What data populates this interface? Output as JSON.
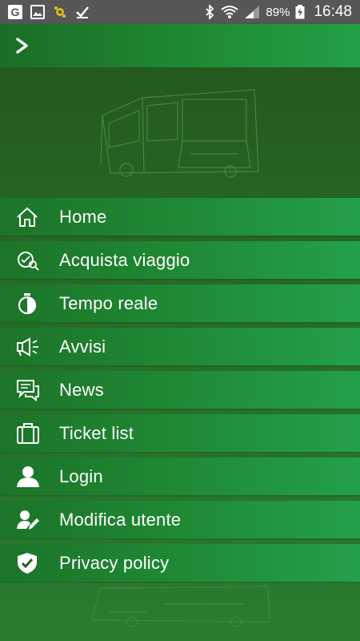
{
  "status_bar": {
    "battery": "89%",
    "time": "16:48",
    "left_icons": [
      "google-icon",
      "image-icon",
      "app-icon",
      "check-icon"
    ],
    "right_icons": [
      "bluetooth-icon",
      "wifi-icon",
      "signal-icon",
      "battery-icon"
    ]
  },
  "app_bar": {
    "toggle_icon": "chevron-right-icon"
  },
  "menu": {
    "items": [
      {
        "label": "Home",
        "icon": "home-icon"
      },
      {
        "label": "Acquista viaggio",
        "icon": "search-ticket-icon"
      },
      {
        "label": "Tempo reale",
        "icon": "stopwatch-icon"
      },
      {
        "label": "Avvisi",
        "icon": "megaphone-icon"
      },
      {
        "label": "News",
        "icon": "chat-bubbles-icon"
      },
      {
        "label": "Ticket list",
        "icon": "briefcase-icon"
      },
      {
        "label": "Login",
        "icon": "user-icon"
      },
      {
        "label": "Modifica utente",
        "icon": "edit-user-icon"
      },
      {
        "label": "Privacy policy",
        "icon": "shield-check-icon"
      }
    ]
  },
  "colors": {
    "status_bar": "#575757",
    "app_bar": "#1f8a32",
    "drawer_background": "#266a24",
    "menu_item": "#1f8732",
    "text": "#ffffff"
  }
}
